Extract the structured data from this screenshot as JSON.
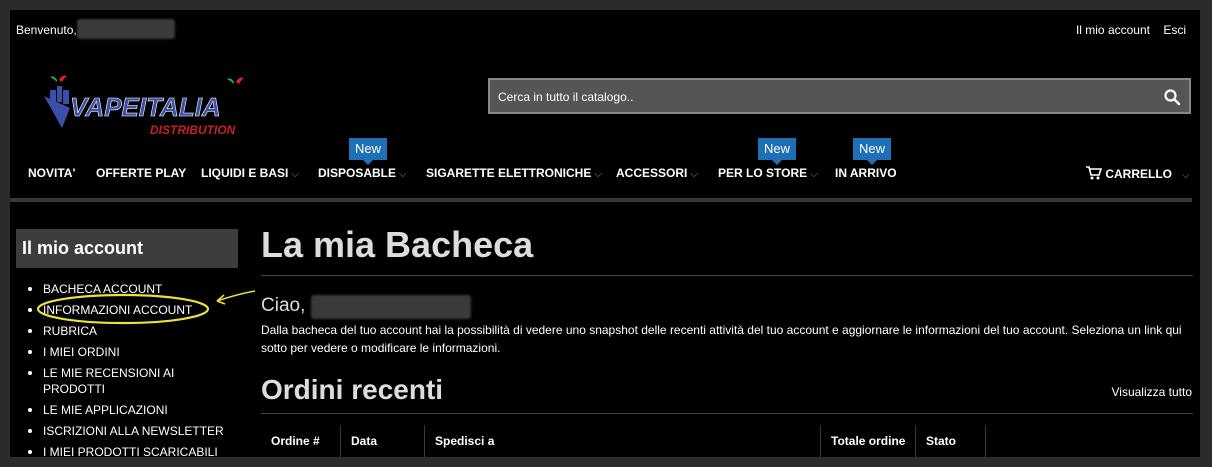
{
  "header": {
    "welcome": "Benvenuto,",
    "links": [
      "Il mio account",
      "Esci"
    ]
  },
  "logo": {
    "main": "VAPEITALIA",
    "sub": "DISTRIBUTION",
    "colors": {
      "main": "#3a4fa8",
      "sub": "#c62026",
      "accent": "#e21f26"
    }
  },
  "search": {
    "placeholder": "Cerca in tutto il catalogo.."
  },
  "nav": {
    "items": [
      {
        "label": "NOVITA'",
        "dropdown": false,
        "badge": ""
      },
      {
        "label": "OFFERTE PLAY",
        "dropdown": false,
        "badge": ""
      },
      {
        "label": "LIQUIDI E BASI",
        "dropdown": true,
        "badge": ""
      },
      {
        "label": "DISPOSABLE",
        "dropdown": true,
        "badge": "New"
      },
      {
        "label": "SIGARETTE ELETTRONICHE",
        "dropdown": true,
        "badge": ""
      },
      {
        "label": "ACCESSORI",
        "dropdown": true,
        "badge": ""
      },
      {
        "label": "PER LO STORE",
        "dropdown": true,
        "badge": "New"
      },
      {
        "label": "IN ARRIVO",
        "dropdown": false,
        "badge": "New"
      }
    ],
    "cart": "CARRELLO"
  },
  "sidebar": {
    "title": "Il mio account",
    "items": [
      "BACHECA ACCOUNT",
      "INFORMAZIONI ACCOUNT",
      "RUBRICA",
      "I MIEI ORDINI",
      "LE MIE RECENSIONI AI PRODOTTI",
      "LE MIE APPLICAZIONI",
      "ISCRIZIONI ALLA NEWSLETTER",
      "I MIEI PRODOTTI SCARICABILI"
    ]
  },
  "main": {
    "title": "La mia Bacheca",
    "greeting": "Ciao,",
    "intro": "Dalla bacheca del tuo account hai la possibilità di vedere uno snapshot delle recenti attività del tuo account e aggiornare le informazioni del tuo account. Seleziona un link qui sotto per vedere o modificare le informazioni.",
    "orders_title": "Ordini recenti",
    "view_all": "Visualizza tutto",
    "columns": [
      "Ordine #",
      "Data",
      "Spedisci a",
      "Totale ordine",
      "Stato",
      ""
    ]
  },
  "colors": {
    "badge": "#1f6fb5",
    "highlight": "#e8e23a",
    "background": "#000000"
  }
}
